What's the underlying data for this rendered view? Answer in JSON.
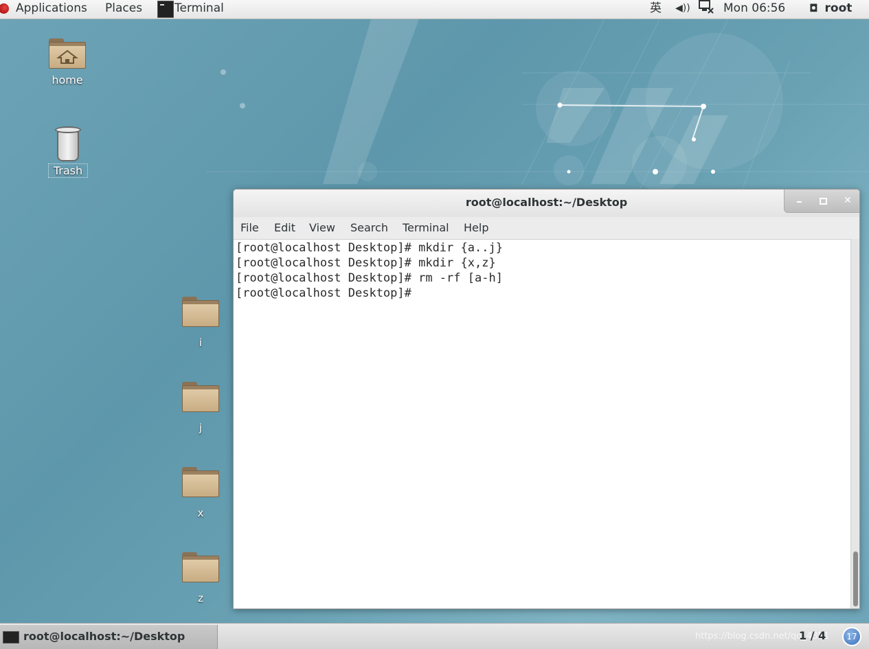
{
  "top_panel": {
    "applications": "Applications",
    "places": "Places",
    "terminal_launcher": "Terminal",
    "ime": "英",
    "volume": "◀))",
    "clock": "Mon 06:56",
    "user": "root"
  },
  "desktop": {
    "icons": [
      {
        "label": "home"
      },
      {
        "label": "Trash"
      },
      {
        "label": "i"
      },
      {
        "label": "j"
      },
      {
        "label": "x"
      },
      {
        "label": "z"
      }
    ]
  },
  "terminal": {
    "title": "root@localhost:~/Desktop",
    "menu": [
      "File",
      "Edit",
      "View",
      "Search",
      "Terminal",
      "Help"
    ],
    "lines": [
      "[root@localhost Desktop]# mkdir {a..j}",
      "[root@localhost Desktop]# mkdir {x,z}",
      "[root@localhost Desktop]# rm -rf [a-h]",
      "[root@localhost Desktop]#"
    ],
    "close_glyph": "✕"
  },
  "bottom_panel": {
    "taskbar_item": "root@localhost:~/Desktop",
    "watermark": "https://blog.csdn.net/qq_4351",
    "workspace": "1 / 4",
    "workspace_badge": "17"
  },
  "colors": {
    "desktop": "#5f98ac",
    "panel": "#e6e6e6",
    "terminal_bg": "#ffffff"
  }
}
